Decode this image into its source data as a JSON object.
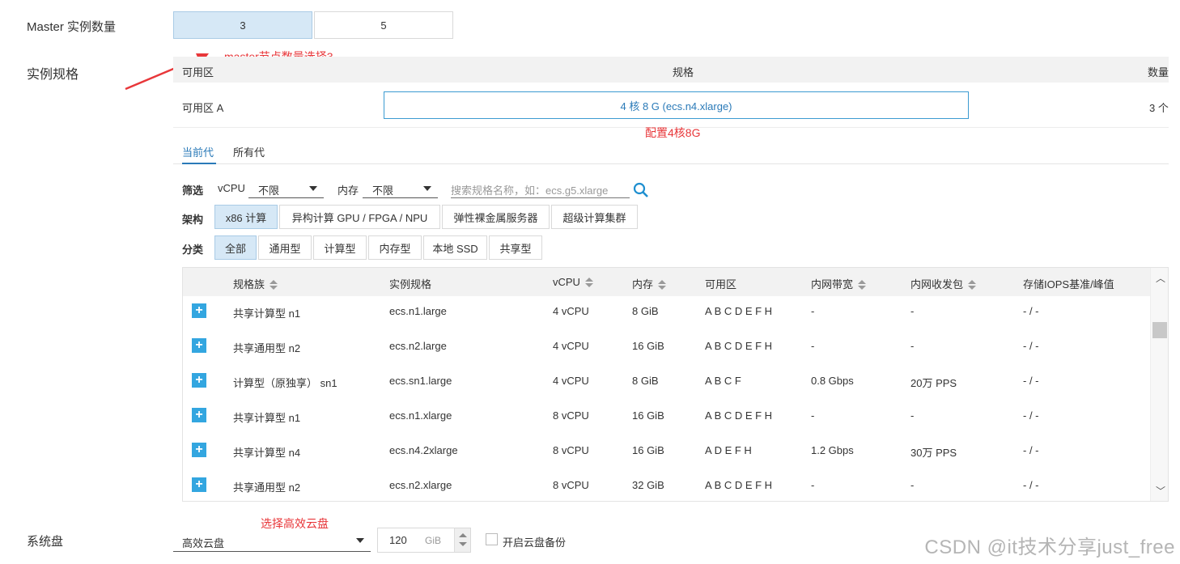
{
  "master": {
    "label": "Master 实例数量",
    "options": [
      "3",
      "5"
    ],
    "selected": "3",
    "annotation": "master节点数量选择3"
  },
  "spec": {
    "label": "实例规格",
    "header": {
      "zone": "可用区",
      "spec": "规格",
      "count": "数量"
    },
    "row": {
      "zone": "可用区 A",
      "spec": "4 核 8 G (ecs.n4.xlarge)",
      "count": "3 个"
    },
    "annotation": "配置4核8G"
  },
  "tabs": [
    "当前代",
    "所有代"
  ],
  "filter": {
    "label": "筛选",
    "vcpu_label": "vCPU",
    "vcpu_value": "不限",
    "mem_label": "内存",
    "mem_value": "不限",
    "search_placeholder": "搜索规格名称，如：ecs.g5.xlarge"
  },
  "arch": {
    "label": "架构",
    "options": [
      "x86 计算",
      "异构计算 GPU / FPGA / NPU",
      "弹性裸金属服务器",
      "超级计算集群"
    ]
  },
  "category": {
    "label": "分类",
    "options": [
      "全部",
      "通用型",
      "计算型",
      "内存型",
      "本地 SSD",
      "共享型"
    ]
  },
  "table": {
    "columns": [
      "规格族",
      "实例规格",
      "vCPU",
      "内存",
      "可用区",
      "内网带宽",
      "内网收发包",
      "存储IOPS基准/峰值"
    ],
    "rows": [
      [
        "共享计算型 n1",
        "ecs.n1.large",
        "4 vCPU",
        "8 GiB",
        "A B C D E F H",
        "-",
        "-",
        "- / -"
      ],
      [
        "共享通用型 n2",
        "ecs.n2.large",
        "4 vCPU",
        "16 GiB",
        "A B C D E F H",
        "-",
        "-",
        "- / -"
      ],
      [
        "计算型（原独享） sn1",
        "ecs.sn1.large",
        "4 vCPU",
        "8 GiB",
        "A B C F",
        "0.8 Gbps",
        "20万 PPS",
        "- / -"
      ],
      [
        "共享计算型 n1",
        "ecs.n1.xlarge",
        "8 vCPU",
        "16 GiB",
        "A B C D E F H",
        "-",
        "-",
        "- / -"
      ],
      [
        "共享计算型 n4",
        "ecs.n4.2xlarge",
        "8 vCPU",
        "16 GiB",
        "A D E F H",
        "1.2 Gbps",
        "30万 PPS",
        "- / -"
      ],
      [
        "共享通用型 n2",
        "ecs.n2.xlarge",
        "8 vCPU",
        "32 GiB",
        "A B C D E F H",
        "-",
        "-",
        "- / -"
      ]
    ]
  },
  "disk": {
    "label": "系统盘",
    "annotation": "选择高效云盘",
    "type": "高效云盘",
    "size": "120",
    "unit": "GiB",
    "backup_label": "开启云盘备份"
  },
  "watermark": "CSDN @it技术分享just_free"
}
